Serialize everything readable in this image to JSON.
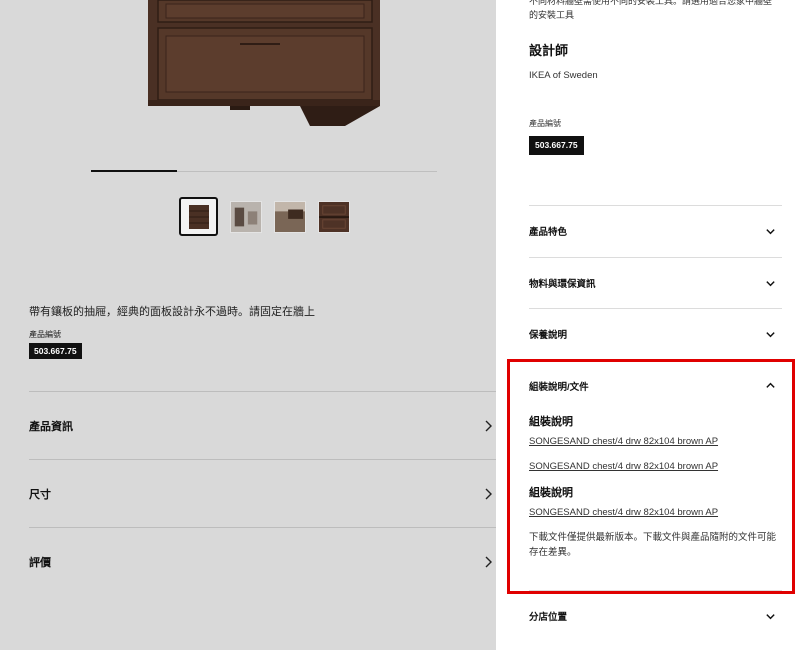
{
  "left": {
    "description": "帶有鑲板的抽屜，經典的面板設計永不過時。請固定在牆上",
    "article_label": "產品編號",
    "article_number": "503.667.75",
    "carousel": {
      "active_index": 0,
      "count": 4
    },
    "accordions": [
      {
        "label": "產品資訊"
      },
      {
        "label": "尺寸"
      },
      {
        "label": "評價"
      }
    ]
  },
  "panel": {
    "top_note": "不同材料牆壁需使用不同的安裝工具。請選用適合您家中牆壁的安裝工具",
    "designer_title": "設計師",
    "designer_name": "IKEA of Sweden",
    "article_label": "產品編號",
    "article_number": "503.667.75",
    "sections": [
      {
        "label": "產品特色"
      },
      {
        "label": "物料與環保資訊"
      },
      {
        "label": "保養說明"
      }
    ],
    "assembly": {
      "label": "組裝說明/文件",
      "heading_1": "組裝說明",
      "link_1": "SONGESAND chest/4 drw 82x104 brown AP",
      "link_2": "SONGESAND chest/4 drw 82x104 brown AP",
      "heading_2": "組裝說明",
      "link_3": "SONGESAND chest/4 drw 82x104 brown AP",
      "note": "下載文件僅提供最新版本。下載文件與產品隨附的文件可能存在差異。"
    },
    "store_label": "分店位置"
  },
  "icons": {
    "chevron_down": "chevron-down-icon",
    "chevron_up": "chevron-up-icon",
    "chevron_right": "chevron-right-icon"
  },
  "colors": {
    "highlight": "#e00000",
    "badge_bg": "#111111"
  }
}
